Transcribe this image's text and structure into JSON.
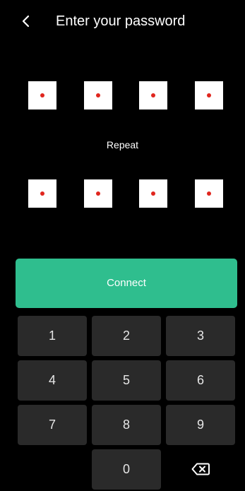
{
  "header": {
    "title": "Enter your password",
    "back_icon": "chevron-left-icon"
  },
  "pin": {
    "first_row_filled": [
      true,
      true,
      true,
      true
    ],
    "repeat_label": "Repeat",
    "second_row_filled": [
      true,
      true,
      true,
      true
    ]
  },
  "connect": {
    "label": "Connect",
    "color": "#2fbe8e"
  },
  "keypad": {
    "keys": [
      "1",
      "2",
      "3",
      "4",
      "5",
      "6",
      "7",
      "8",
      "9",
      "0"
    ],
    "backspace_icon": "backspace-icon"
  },
  "colors": {
    "background": "#000000",
    "key_background": "#2a2a2a",
    "dot": "#e0261e"
  }
}
